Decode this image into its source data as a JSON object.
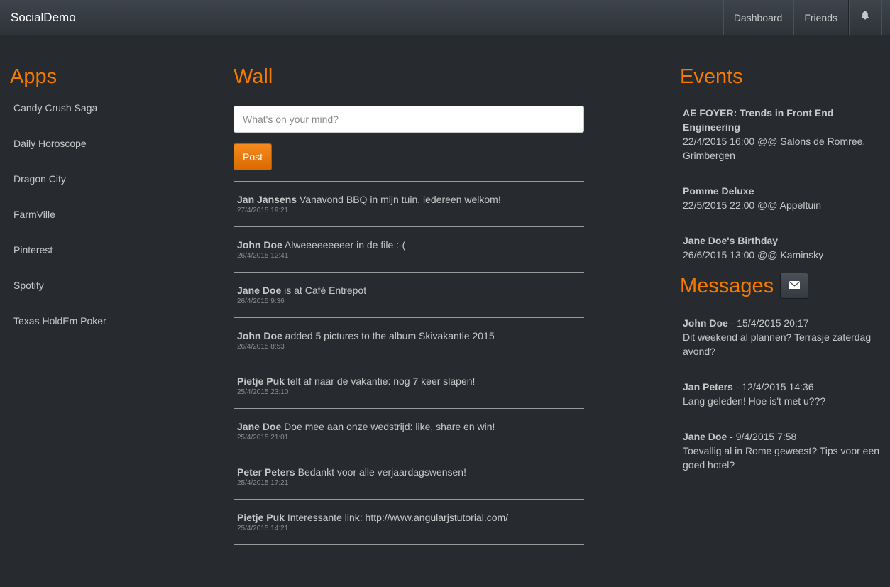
{
  "navbar": {
    "brand": "SocialDemo",
    "items": [
      {
        "label": "Dashboard"
      },
      {
        "label": "Friends"
      }
    ],
    "bell_icon": "bell-icon"
  },
  "apps": {
    "title": "Apps",
    "items": [
      {
        "label": "Candy Crush Saga"
      },
      {
        "label": "Daily Horoscope"
      },
      {
        "label": "Dragon City"
      },
      {
        "label": "FarmVille"
      },
      {
        "label": "Pinterest"
      },
      {
        "label": "Spotify"
      },
      {
        "label": "Texas HoldEm Poker"
      }
    ]
  },
  "wall": {
    "title": "Wall",
    "input_placeholder": "What's on your mind?",
    "input_value": "",
    "post_button": "Post",
    "posts": [
      {
        "author": "Jan Jansens",
        "text": "Vanavond BBQ in mijn tuin, iedereen welkom!",
        "time": "27/4/2015 19:21"
      },
      {
        "author": "John Doe",
        "text": "Alweeeeeeeeer in de file :-(",
        "time": "26/4/2015 12:41"
      },
      {
        "author": "Jane Doe",
        "text": "is at Café Entrepot",
        "time": "26/4/2015 9:36"
      },
      {
        "author": "John Doe",
        "text": "added 5 pictures to the album Skivakantie 2015",
        "time": "26/4/2015 8:53"
      },
      {
        "author": "Pietje Puk",
        "text": "telt af naar de vakantie: nog 7 keer slapen!",
        "time": "25/4/2015 23:10"
      },
      {
        "author": "Jane Doe",
        "text": "Doe mee aan onze wedstrijd: like, share en win!",
        "time": "25/4/2015 21:01"
      },
      {
        "author": "Peter Peters",
        "text": "Bedankt voor alle verjaardagswensen!",
        "time": "25/4/2015 17:21"
      },
      {
        "author": "Pietje Puk",
        "text": "Interessante link: http://www.angularjstutorial.com/",
        "time": "25/4/2015 14:21"
      }
    ]
  },
  "events": {
    "title": "Events",
    "items": [
      {
        "title": "AE FOYER: Trends in Front End Engineering",
        "details": "22/4/2015 16:00 @@ Salons de Romree, Grimbergen"
      },
      {
        "title": "Pomme Deluxe",
        "details": "22/5/2015 22:00 @@ Appeltuin"
      },
      {
        "title": "Jane Doe's Birthday",
        "details": "26/6/2015 13:00 @@ Kaminsky"
      }
    ]
  },
  "messages": {
    "title": "Messages",
    "mail_icon": "envelope-icon",
    "items": [
      {
        "author": "John Doe",
        "time": " - 15/4/2015 20:17",
        "text": "Dit weekend al plannen? Terrasje zaterdag avond?"
      },
      {
        "author": "Jan Peters",
        "time": " - 12/4/2015 14:36",
        "text": "Lang geleden! Hoe is't met u???"
      },
      {
        "author": "Jane Doe",
        "time": " - 9/4/2015 7:58",
        "text": "Toevallig al in Rome geweest? Tips voor een goed hotel?"
      }
    ]
  },
  "colors": {
    "background": "#272b30",
    "accent": "#f57a00",
    "text": "#c8c8c8"
  }
}
